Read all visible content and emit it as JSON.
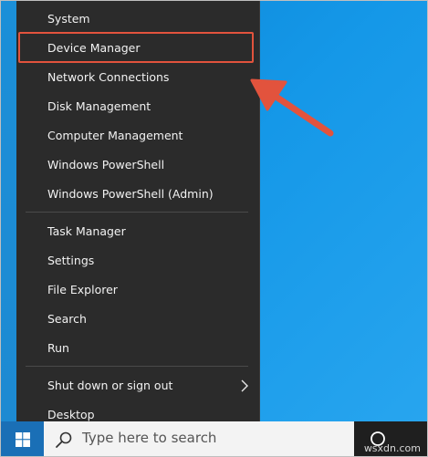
{
  "menu": {
    "items": [
      {
        "label": "System"
      },
      {
        "label": "Device Manager"
      },
      {
        "label": "Network Connections"
      },
      {
        "label": "Disk Management"
      },
      {
        "label": "Computer Management"
      },
      {
        "label": "Windows PowerShell"
      },
      {
        "label": "Windows PowerShell (Admin)"
      },
      {
        "label": "Task Manager"
      },
      {
        "label": "Settings"
      },
      {
        "label": "File Explorer"
      },
      {
        "label": "Search"
      },
      {
        "label": "Run"
      },
      {
        "label": "Shut down or sign out"
      },
      {
        "label": "Desktop"
      }
    ],
    "highlighted_item": "Device Manager",
    "highlight_color": "#e2533d"
  },
  "annotation": {
    "arrow_color": "#e2533d",
    "arrow_icon": "arrow-pointing-left-icon"
  },
  "taskbar": {
    "search_placeholder": "Type here to search",
    "start_icon": "windows-logo-icon",
    "search_icon": "search-icon",
    "task_view_icon": "cortana-circle-icon"
  },
  "watermark": "wsxdn.com",
  "colors": {
    "desktop": "#1598e8",
    "menu_bg": "#2b2b2b",
    "taskbar_bg": "#1f1f1f"
  }
}
